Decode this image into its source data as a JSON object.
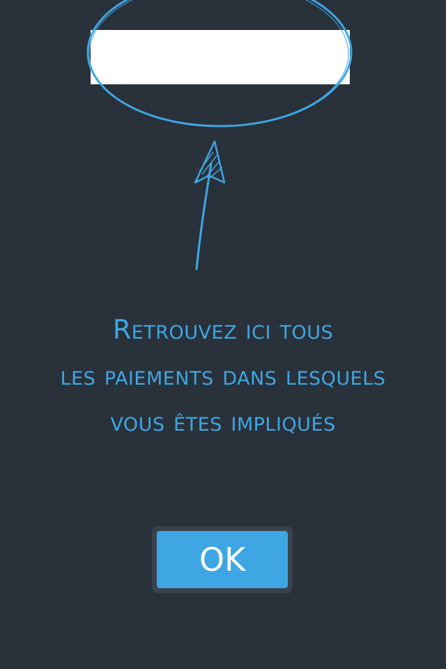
{
  "tooltip": {
    "lines": [
      "Retrouvez ici tous",
      "les paiements dans lesquels",
      "vous êtes impliqués"
    ]
  },
  "button": {
    "ok_label": "OK"
  },
  "colors": {
    "background": "#29313b",
    "accent": "#3ea7e3",
    "highlight_bar": "#ffffff",
    "button_frame": "#39424c"
  }
}
